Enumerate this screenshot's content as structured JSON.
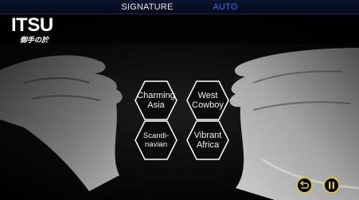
{
  "topbar": {
    "tabs": [
      {
        "label": "SIGNATURE"
      },
      {
        "label": "AUTO"
      }
    ]
  },
  "logo": {
    "main": "ITSU",
    "sub": "御手の於"
  },
  "programs": [
    {
      "line1": "Charming",
      "line2": "Asia"
    },
    {
      "line1": "West",
      "line2": "Cowboy"
    },
    {
      "line1": "Scandi-",
      "line2": "navian"
    },
    {
      "line1": "Vibrant",
      "line2": "Africa"
    }
  ],
  "controls": {
    "back_icon": "return-arrow-icon",
    "pause_icon": "pause-icon",
    "accent_color": "#d9c040"
  },
  "colors": {
    "tab_active": "#2f6fff",
    "hex_fill": "#0b0b0b",
    "hex_border": "#ffffff"
  }
}
